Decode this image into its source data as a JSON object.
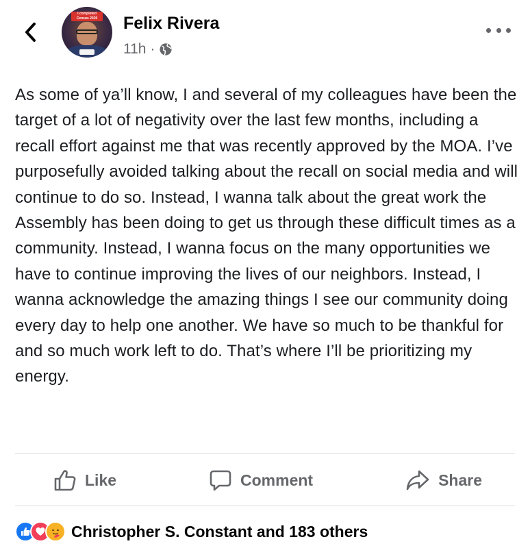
{
  "header": {
    "back_icon": "chevron-left-icon",
    "author_name": "Felix Rivera",
    "timestamp": "11h",
    "separator": "·",
    "audience_icon": "globe-icon",
    "avatar_banner": "I completed Census 2020",
    "more_icon": "more-horizontal-icon"
  },
  "post": {
    "text": "As some of ya’ll know, I and several of my colleagues have been the target of a lot of negativity over the last few months, including a recall effort against me that was recently approved by the MOA. I’ve purposefully avoided talking about the recall on social media and will continue to do so. Instead, I wanna talk about the great work the Assembly has been doing to get us through these difficult times as a community. Instead, I wanna focus on the many opportunities we have to continue improving the lives of our neighbors. Instead, I wanna acknowledge the amazing things I see our community doing every day to help one another. We have so much to be thankful for and so much work left to do. That’s where I’ll be prioritizing my energy."
  },
  "actions": {
    "like": {
      "label": "Like",
      "icon": "thumbs-up-icon"
    },
    "comment": {
      "label": "Comment",
      "icon": "comment-bubble-icon"
    },
    "share": {
      "label": "Share",
      "icon": "share-arrow-icon"
    }
  },
  "reactions": {
    "icons": [
      "like-reaction-icon",
      "love-reaction-icon",
      "care-reaction-icon"
    ],
    "summary": "Christopher S. Constant and 183 others"
  },
  "colors": {
    "text": "#050505",
    "secondary": "#65676b",
    "like_blue": "#1877f2",
    "love_red": "#f33e58",
    "care_yellow": "#f7b125",
    "divider": "#dadde1"
  }
}
